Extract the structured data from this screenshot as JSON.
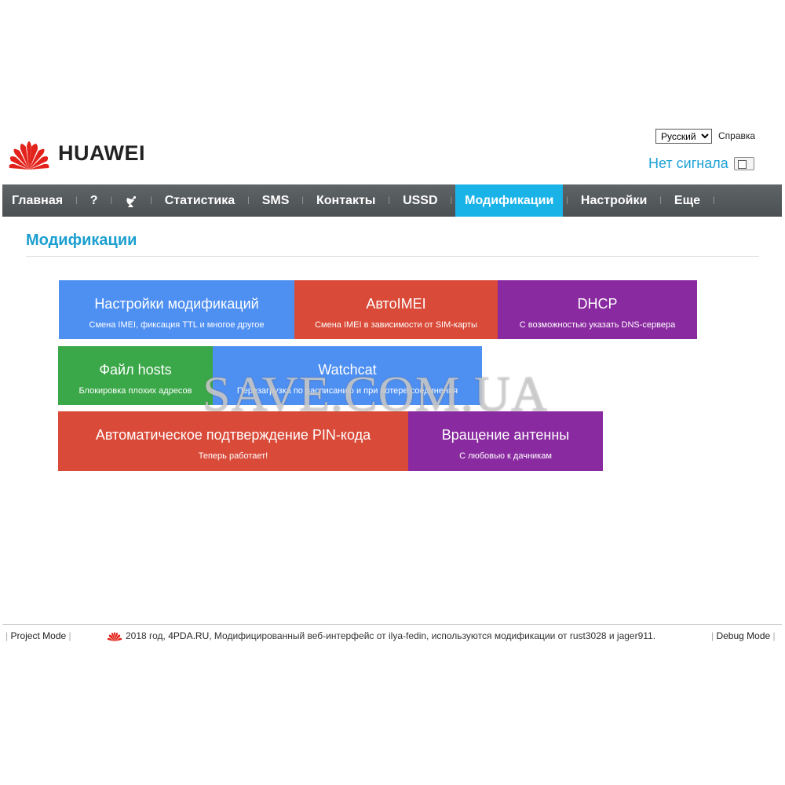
{
  "brand": {
    "name": "HUAWEI",
    "logo_icon": "huawei-petals-logo",
    "color": "#e3231b"
  },
  "header": {
    "language": {
      "selected": "Русский",
      "options": [
        "Русский"
      ]
    },
    "help_label": "Справка",
    "signal_text": "Нет сигнала",
    "signal_icon": "no-signal-icon"
  },
  "nav": {
    "items": [
      {
        "label": "Главная"
      },
      {
        "label": "?"
      },
      {
        "icon": "satellite-dish-icon"
      },
      {
        "label": "Статистика"
      },
      {
        "label": "SMS"
      },
      {
        "label": "Контакты"
      },
      {
        "label": "USSD"
      },
      {
        "label": "Модификации",
        "active": true
      },
      {
        "label": "Настройки"
      },
      {
        "label": "Еще"
      }
    ],
    "active_color": "#1ab3e8"
  },
  "page": {
    "title": "Модификации"
  },
  "tiles": [
    {
      "title": "Настройки модификаций",
      "subtitle": "Смена IMEI, фиксация TTL и многое другое",
      "color": "#4e8ff2"
    },
    {
      "title": "АвтоIMEI",
      "subtitle": "Смена IMEI в зависимости от SIM-карты",
      "color": "#d94a38"
    },
    {
      "title": "DHCP",
      "subtitle": "С возможностью указать DNS-сервера",
      "color": "#8a2aa0"
    },
    {
      "title": "Файл hosts",
      "subtitle": "Блокировка плохих адресов",
      "color": "#3aa748"
    },
    {
      "title": "Watchcat",
      "subtitle": "Перезагрузка по расписанию и при потере соединения",
      "color": "#4e8ff2"
    },
    {
      "title": "Автоматическое подтверждение PIN-кода",
      "subtitle": "Теперь работает!",
      "color": "#d94a38"
    },
    {
      "title": "Вращение антенны",
      "subtitle": "С любовью к дачникам",
      "color": "#8a2aa0"
    }
  ],
  "watermark": "SAVE.COM.UA",
  "footer": {
    "project_mode": "Project Mode",
    "year_text": "2018 год,",
    "site_link": "4PDA.RU",
    "credits": ", Модифицированный веб-интерфейс от ilya-fedin, используются модификации от rust3028 и jager911.",
    "debug_mode": "Debug Mode",
    "bar": "|"
  }
}
